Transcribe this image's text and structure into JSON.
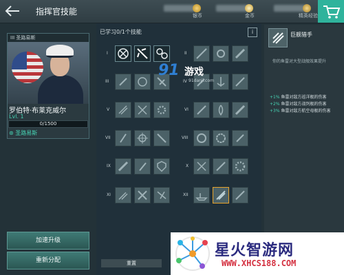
{
  "header": {
    "title": "指挥官技能",
    "resources": [
      {
        "label": "银币",
        "icon": "silver-coin-icon"
      },
      {
        "label": "金币",
        "icon": "gold-coin-icon"
      },
      {
        "label": "精英经验",
        "icon": "elite-xp-icon"
      }
    ],
    "icons": {
      "back": "back-arrow-icon",
      "shop": "cart-icon"
    }
  },
  "commander": {
    "ship_header": "III 圣路易斯",
    "name": "罗伯特·布莱克威尔",
    "level": "Lvl. 1",
    "xp": "0/1500",
    "ship": "圣路易斯"
  },
  "buttons": {
    "accelerate": "加速升级",
    "reassign": "重新分配",
    "reset": "重置"
  },
  "skills_panel": {
    "learned": "已学习0/1个技能",
    "info": "i",
    "tiers": [
      "I",
      "II",
      "III",
      "IV",
      "V",
      "VI",
      "VII",
      "VIII",
      "IX",
      "X",
      "XI",
      "XII"
    ]
  },
  "detail": {
    "name": "巨舰猎手",
    "desc": "你的鱼雷对大型战舰效果提升",
    "bonuses": [
      {
        "value": "+1%",
        "text": "鱼雷对敌方巡洋舰的伤害"
      },
      {
        "value": "+2%",
        "text": "鱼雷对敌方战列舰的伤害"
      },
      {
        "value": "+3%",
        "text": "鱼雷对敌方航空母舰的伤害"
      }
    ]
  },
  "watermarks": {
    "site1": "91",
    "site1_cn": "游戏",
    "site1_url": "91danji.com",
    "site2": "星火智游网",
    "site2_url": "WWW.XHCS188.COM"
  },
  "colors": {
    "accent": "#47d4b4",
    "selected": "#e5a22b",
    "shop": "#2fb39c"
  }
}
